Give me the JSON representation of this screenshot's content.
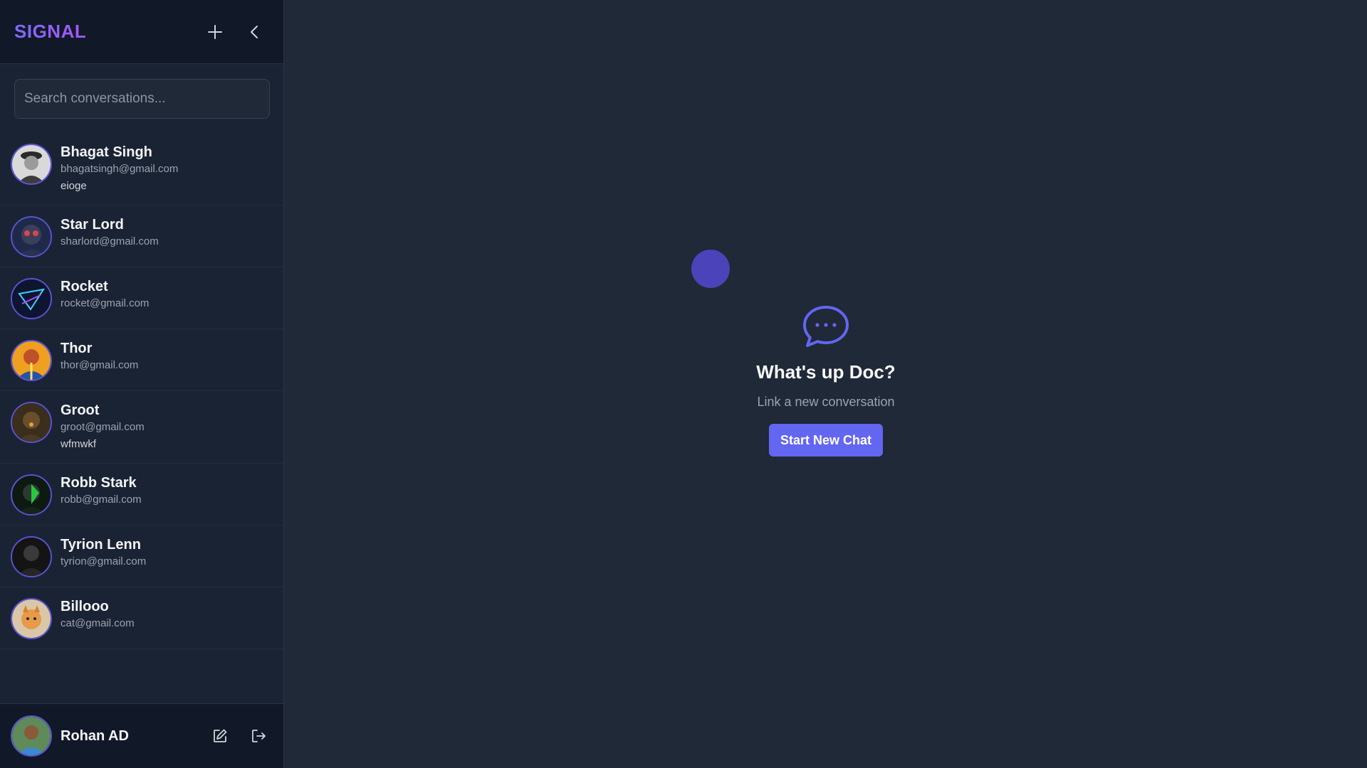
{
  "app": {
    "title": "SIGNAL"
  },
  "search": {
    "placeholder": "Search conversations..."
  },
  "conversations": [
    {
      "name": "Bhagat Singh",
      "email": "bhagatsingh@gmail.com",
      "last_message": "eioge"
    },
    {
      "name": "Star Lord",
      "email": "sharlord@gmail.com",
      "last_message": ""
    },
    {
      "name": "Rocket",
      "email": "rocket@gmail.com",
      "last_message": ""
    },
    {
      "name": "Thor",
      "email": "thor@gmail.com",
      "last_message": ""
    },
    {
      "name": "Groot",
      "email": "groot@gmail.com",
      "last_message": "wfmwkf"
    },
    {
      "name": "Robb Stark",
      "email": "robb@gmail.com",
      "last_message": ""
    },
    {
      "name": "Tyrion Lenn",
      "email": "tyrion@gmail.com",
      "last_message": ""
    },
    {
      "name": "Billooo",
      "email": "cat@gmail.com",
      "last_message": ""
    }
  ],
  "current_user": {
    "name": "Rohan AD"
  },
  "main": {
    "title": "What's up Doc?",
    "subtitle": "Link a new conversation",
    "button": "Start New Chat"
  },
  "icons": {
    "header": [
      "plus-icon",
      "chevron-left-icon"
    ],
    "footer": [
      "edit-icon",
      "logout-icon"
    ],
    "main": "chat-bubble-icon"
  },
  "colors": {
    "accent": "#6366f1",
    "sidebar_bg": "#1a2333",
    "header_bg": "#111827",
    "main_bg": "#1f2937",
    "avatar_ring": "#5b52d6"
  }
}
